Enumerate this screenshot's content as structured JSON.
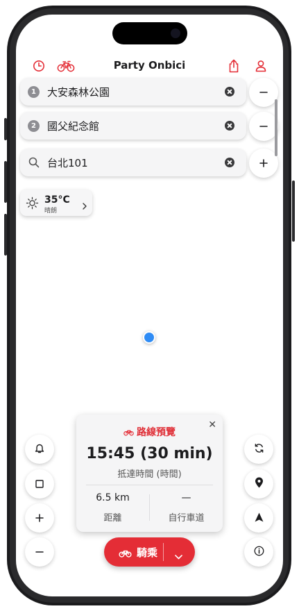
{
  "app": {
    "title": "Party Onbici",
    "accent_color": "#e42d36"
  },
  "topbar": {
    "left_icons": [
      "clock-icon",
      "bicycle-icon"
    ],
    "right_icons": [
      "share-icon",
      "user-icon"
    ]
  },
  "waypoints": [
    {
      "index": "1",
      "label": "大安森林公園"
    },
    {
      "index": "2",
      "label": "國父紀念館"
    }
  ],
  "destination": {
    "value": "台北101"
  },
  "weather": {
    "temperature": "35°C",
    "condition": "晴朗"
  },
  "route_preview": {
    "title": "路線預覽",
    "eta": "15:45 (30 min)",
    "eta_caption": "抵達時間 (時間)",
    "distance_value": "6.5 km",
    "distance_label": "距離",
    "bike_lane_value": "—",
    "bike_lane_label": "自行車道"
  },
  "ride_button": {
    "label": "騎乘"
  }
}
